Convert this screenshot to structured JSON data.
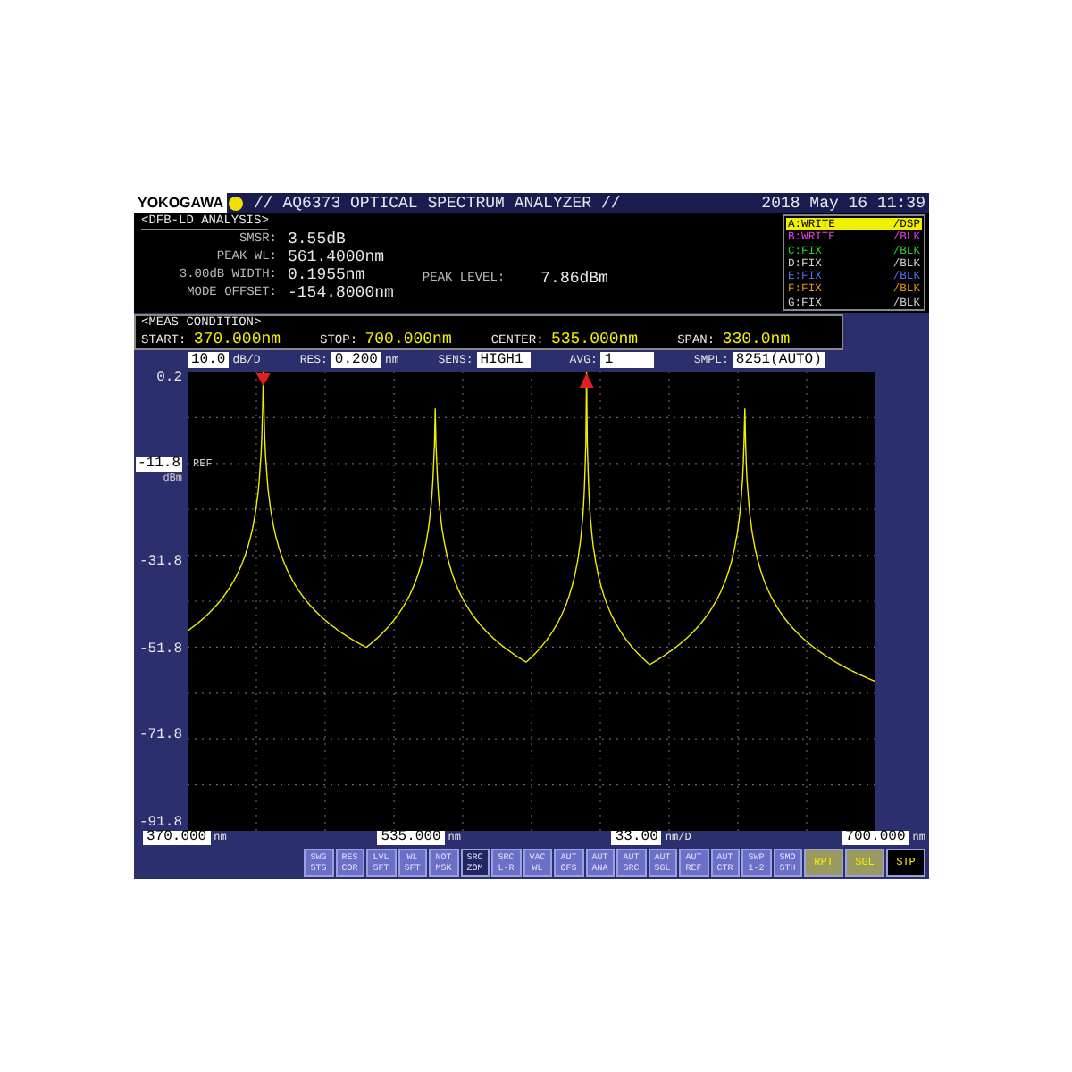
{
  "header": {
    "brand": "YOKOGAWA",
    "title": "// AQ6373 OPTICAL SPECTRUM ANALYZER //",
    "datetime": "2018 May 16 11:39"
  },
  "analysis": {
    "title": "<DFB-LD ANALYSIS>",
    "rows": [
      {
        "label": "SMSR:",
        "value": "3.55dB"
      },
      {
        "label": "PEAK WL:",
        "value": "561.4000nm"
      },
      {
        "label": "3.00dB WIDTH:",
        "value": "0.1955nm"
      },
      {
        "label": "MODE OFFSET:",
        "value": "-154.8000nm"
      }
    ],
    "peak_level_label": "PEAK LEVEL:",
    "peak_level_value": "7.86dBm"
  },
  "traces": [
    {
      "name": "A:WRITE",
      "mode": "/DSP",
      "color": "#f0f000",
      "selected": true
    },
    {
      "name": "B:WRITE",
      "mode": "/BLK",
      "color": "#e040e0",
      "selected": false
    },
    {
      "name": "C:FIX",
      "mode": "/BLK",
      "color": "#30d030",
      "selected": false
    },
    {
      "name": "D:FIX",
      "mode": "/BLK",
      "color": "#d0d0d0",
      "selected": false
    },
    {
      "name": "E:FIX",
      "mode": "/BLK",
      "color": "#5070f0",
      "selected": false
    },
    {
      "name": "F:FIX",
      "mode": "/BLK",
      "color": "#e09020",
      "selected": false
    },
    {
      "name": "G:FIX",
      "mode": "/BLK",
      "color": "#d0d0d0",
      "selected": false
    }
  ],
  "meas_condition": {
    "title": "<MEAS CONDITION>",
    "items": [
      {
        "label": "START:",
        "value": "370.000nm"
      },
      {
        "label": "STOP:",
        "value": "700.000nm"
      },
      {
        "label": "CENTER:",
        "value": "535.000nm"
      },
      {
        "label": "SPAN:",
        "value": "330.0nm"
      }
    ]
  },
  "settings": [
    {
      "kind": "scale",
      "value": "10.0",
      "unit": "dB/D"
    },
    {
      "kind": "field",
      "label": "RES:",
      "value": "0.200",
      "unit": "nm"
    },
    {
      "kind": "field",
      "label": "SENS:",
      "value": "HIGH1"
    },
    {
      "kind": "field",
      "label": "AVG:",
      "value": "1"
    },
    {
      "kind": "field",
      "label": "SMPL:",
      "value": "8251(AUTO)"
    }
  ],
  "y_axis": [
    {
      "value": "0.2"
    },
    {
      "value": "-11.8",
      "ref": "REF",
      "unit": "dBm"
    },
    {
      "value": "-31.8"
    },
    {
      "value": "-51.8"
    },
    {
      "value": "-71.8"
    },
    {
      "value": "-91.8"
    }
  ],
  "x_axis": [
    {
      "value": "370.000",
      "unit": "nm"
    },
    {
      "value": "535.000",
      "unit": "nm"
    },
    {
      "value": "33.00",
      "unit": "nm/D"
    },
    {
      "value": "700.000",
      "unit": "nm"
    }
  ],
  "softkeys": [
    {
      "kind": "function",
      "top": "SWG",
      "bottom": "STS",
      "selected": false
    },
    {
      "kind": "function",
      "top": "RES",
      "bottom": "COR",
      "selected": false
    },
    {
      "kind": "function",
      "top": "LVL",
      "bottom": "SFT",
      "selected": false
    },
    {
      "kind": "function",
      "top": "WL",
      "bottom": "SFT",
      "selected": false
    },
    {
      "kind": "function",
      "top": "NOT",
      "bottom": "MSK",
      "selected": false
    },
    {
      "kind": "function",
      "top": "SRC",
      "bottom": "ZOM",
      "selected": true
    },
    {
      "kind": "function",
      "top": "SRC",
      "bottom": "L-R",
      "selected": false
    },
    {
      "kind": "function",
      "top": "VAC",
      "bottom": "WL",
      "selected": false
    },
    {
      "kind": "function",
      "top": "AUT",
      "bottom": "OFS",
      "selected": false
    },
    {
      "kind": "function",
      "top": "AUT",
      "bottom": "ANA",
      "selected": false
    },
    {
      "kind": "function",
      "top": "AUT",
      "bottom": "SRC",
      "selected": false
    },
    {
      "kind": "function",
      "top": "AUT",
      "bottom": "SGL",
      "selected": false
    },
    {
      "kind": "function",
      "top": "AUT",
      "bottom": "REF",
      "selected": false
    },
    {
      "kind": "function",
      "top": "AUT",
      "bottom": "CTR",
      "selected": false
    },
    {
      "kind": "function",
      "top": "SWP",
      "bottom": "1-2",
      "selected": false
    },
    {
      "kind": "function",
      "top": "SMO",
      "bottom": "STH",
      "selected": false
    },
    {
      "kind": "sweep",
      "top": "RPT",
      "selected": false
    },
    {
      "kind": "sweep",
      "top": "SGL",
      "selected": false
    },
    {
      "kind": "sweep",
      "top": "STP",
      "selected": true
    }
  ]
}
